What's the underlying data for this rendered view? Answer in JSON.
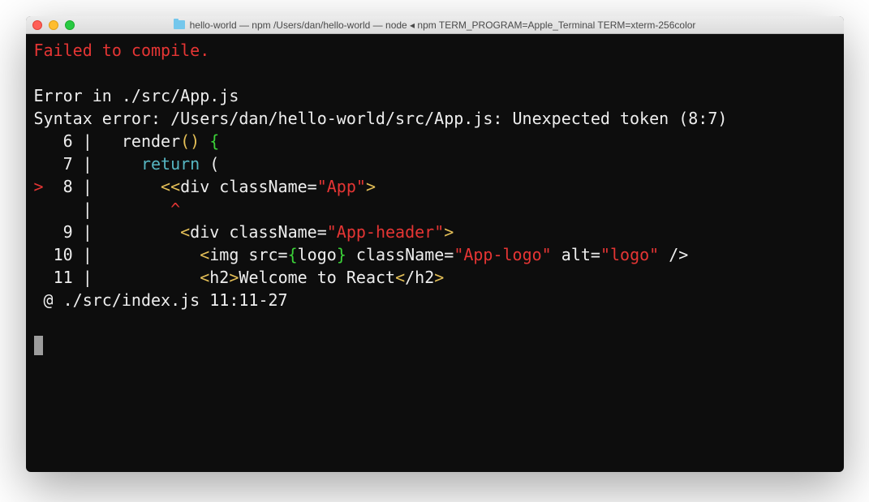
{
  "window": {
    "title": "hello-world — npm  /Users/dan/hello-world — node ◂ npm TERM_PROGRAM=Apple_Terminal TERM=xterm-256color"
  },
  "error": {
    "heading": "Failed to compile.",
    "blank": "",
    "file_line": "Error in ./src/App.js",
    "syntax_line": "Syntax error: /Users/dan/hello-world/src/App.js: Unexpected token (8:7)",
    "lines": {
      "l6": {
        "gutter": "   6 | ",
        "indent": "  render",
        "parens": "()",
        "brace_space": " ",
        "brace": "{"
      },
      "l7": {
        "gutter": "   7 | ",
        "indent": "    ",
        "return": "return",
        "rest": " ("
      },
      "l8": {
        "arrow": ">",
        "gutter": "  8 | ",
        "indent": "      ",
        "lt1": "<",
        "lt2": "<",
        "div_text": "div className=",
        "app": "\"App\"",
        "gt": ">"
      },
      "caret": {
        "gutter": "     | ",
        "spaces": "       ",
        "caret": "^"
      },
      "l9": {
        "gutter": "   9 | ",
        "indent": "        ",
        "lt": "<",
        "div_text": "div className=",
        "val": "\"App-header\"",
        "gt": ">"
      },
      "l10": {
        "gutter": "  10 | ",
        "indent": "          ",
        "lt": "<",
        "img_text": "img src=",
        "lb": "{",
        "logo": "logo",
        "rb": "}",
        "cn": " className=",
        "applogo": "\"App-logo\"",
        "alt": " alt=",
        "logostr": "\"logo\"",
        "close": " />"
      },
      "l11": {
        "gutter": "  11 | ",
        "indent": "          ",
        "lt": "<",
        "h2o": "h2",
        "gt": ">",
        "text": "Welcome to React",
        "lt2": "<",
        "slash": "/",
        "h2c": "h2",
        "gt2": ">"
      }
    },
    "at_line": " @ ./src/index.js 11:11-27"
  }
}
